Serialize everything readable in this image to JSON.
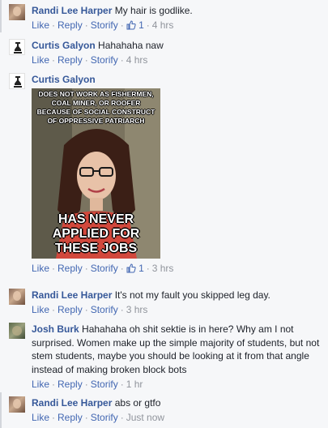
{
  "comments": [
    {
      "author": "Randi Lee Harper",
      "text": "My hair is godlike.",
      "actions": {
        "like": "Like",
        "reply": "Reply",
        "storify": "Storify"
      },
      "likes": "1",
      "time": "4 hrs"
    },
    {
      "author": "Curtis Galyon",
      "text": "Hahahaha naw",
      "actions": {
        "like": "Like",
        "reply": "Reply",
        "storify": "Storify"
      },
      "time": "4 hrs"
    },
    {
      "author": "Curtis Galyon",
      "meme": {
        "top_text": "Does not work as fishermen, coal miner, or roofer because of social construct of oppressive patriarch",
        "bottom_text": "Has never applied for these jobs"
      },
      "actions": {
        "like": "Like",
        "reply": "Reply",
        "storify": "Storify"
      },
      "likes": "1",
      "time": "3 hrs"
    },
    {
      "author": "Randi Lee Harper",
      "text": "It's not my fault you skipped leg day.",
      "actions": {
        "like": "Like",
        "reply": "Reply",
        "storify": "Storify"
      },
      "time": "3 hrs"
    },
    {
      "author": "Josh Burk",
      "text": "Hahahaha oh shit sektie is in here? Why am I not surprised. Women make up the simple majority of students, but not stem students, maybe you should be looking at it from that angle instead of making broken block bots",
      "actions": {
        "like": "Like",
        "reply": "Reply",
        "storify": "Storify"
      },
      "time": "1 hr"
    },
    {
      "author": "Randi Lee Harper",
      "text": "abs or gtfo",
      "actions": {
        "like": "Like",
        "reply": "Reply",
        "storify": "Storify"
      },
      "time": "Just now"
    }
  ],
  "icons": {
    "like": "thumbs-up-icon"
  },
  "colors": {
    "author": "#365899",
    "link": "#4267b2",
    "meta": "#90949c",
    "background": "#f6f7f9"
  }
}
